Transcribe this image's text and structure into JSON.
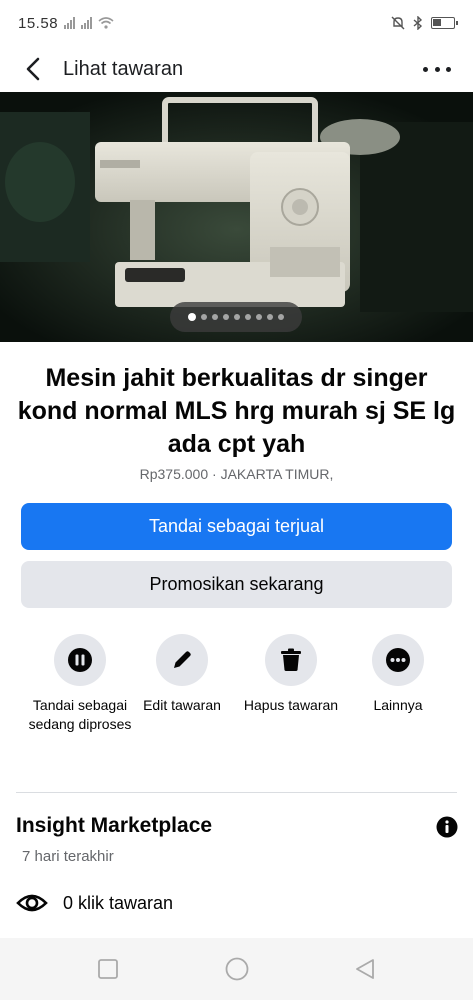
{
  "status_bar": {
    "time": "15.58",
    "icons": [
      "signal-icon",
      "signal-icon",
      "wifi-icon",
      "mute-icon",
      "bluetooth-icon",
      "battery-icon"
    ]
  },
  "header": {
    "title": "Lihat tawaran",
    "back_icon": "chevron-left-icon",
    "more_icon": "more-horizontal-icon"
  },
  "photo": {
    "description_icon": "product-photo",
    "carousel": {
      "total": 9,
      "active_index": 0
    }
  },
  "listing": {
    "title": "Mesin jahit berkualitas dr singer kond normal MLS hrg murah sj SE lg ada cpt yah",
    "meta": "Rp375.000 · JAKARTA TIMUR,"
  },
  "buttons": {
    "primary_label": "Tandai sebagai terjual",
    "secondary_label": "Promosikan sekarang"
  },
  "actions": [
    {
      "label": "Tandai sebagai sedang diproses",
      "icon": "pause-icon"
    },
    {
      "label": "Edit tawaran",
      "icon": "pencil-icon"
    },
    {
      "label": "Hapus tawaran",
      "icon": "trash-icon"
    },
    {
      "label": "Lainnya",
      "icon": "more-horizontal-icon"
    }
  ],
  "insights": {
    "title": "Insight Marketplace",
    "subtitle": "7 hari terakhir",
    "clicks": "0 klik tawaran",
    "info_icon": "info-icon"
  },
  "colors": {
    "primary": "#1877f2",
    "secondary_bg": "#e4e6eb",
    "text": "#050505",
    "muted": "#65676b"
  }
}
